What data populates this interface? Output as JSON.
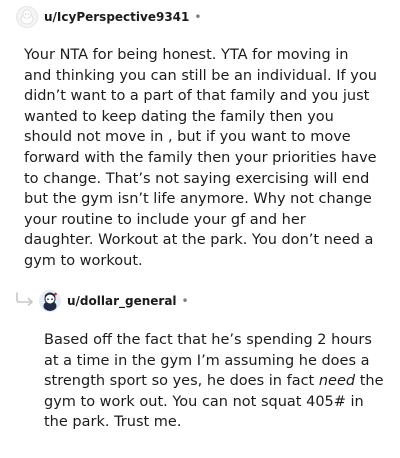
{
  "comments": [
    {
      "username": "u/IcyPerspective9341",
      "separator": "•",
      "avatar_icon": "snoo-ghost-avatar-icon",
      "body": "Your NTA for being honest. YTA for moving in and thinking you can still be an individual. If you didn’t want to a part of that family and you just wanted to keep dating the family then you should not move in , but if you want to move forward with the family then your priorities have to change. That’s not saying exercising will end but the gym isn’t life anymore. Why not change your routine to include your gf and her daughter. Workout at the park. You don’t need a gym to workout."
    },
    {
      "username": "u/dollar_general",
      "separator": "•",
      "avatar_icon": "snoo-character-avatar-icon",
      "reply_icon": "reply-arrow-icon",
      "body_before": "Based off the fact that he’s spending 2 hours at a time in the gym I’m assuming he does a strength sport so yes, he does in fact ",
      "body_emphasis": "need",
      "body_after": " the gym to work out. You can not squat 405# in the park. Trust me."
    }
  ],
  "colors": {
    "text": "#1c1c1c",
    "meta": "#7c7c7c",
    "reply_line": "#c7c7c7"
  }
}
